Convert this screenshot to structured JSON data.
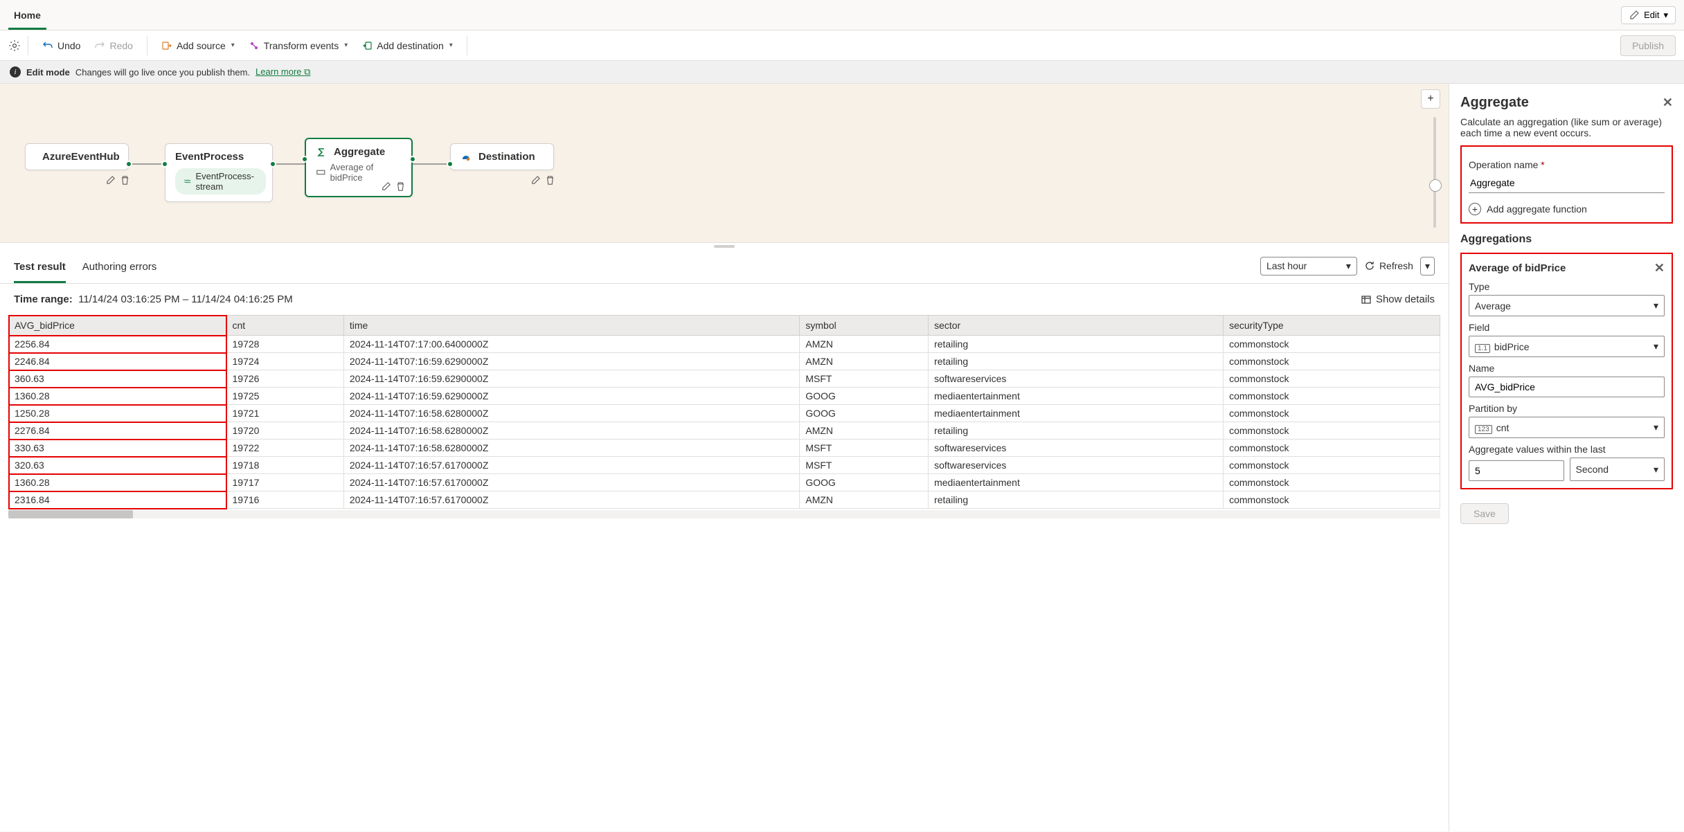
{
  "tabs": {
    "home": "Home"
  },
  "editButton": "Edit",
  "toolbar": {
    "undo": "Undo",
    "redo": "Redo",
    "addSource": "Add source",
    "transformEvents": "Transform events",
    "addDestination": "Add destination",
    "publish": "Publish"
  },
  "infoBar": {
    "mode": "Edit mode",
    "msg": "Changes will go live once you publish them.",
    "link": "Learn more"
  },
  "canvas": {
    "nodes": {
      "source": {
        "title": "AzureEventHub"
      },
      "process": {
        "title": "EventProcess",
        "stream": "EventProcess-stream"
      },
      "aggregate": {
        "title": "Aggregate",
        "subtitle": "Average of bidPrice"
      },
      "destination": {
        "title": "Destination"
      }
    }
  },
  "results": {
    "tabs": {
      "test": "Test result",
      "errors": "Authoring errors"
    },
    "timeFilter": "Last hour",
    "refresh": "Refresh",
    "timeRangeLabel": "Time range:",
    "timeRangeValue": "11/14/24 03:16:25 PM  –  11/14/24 04:16:25 PM",
    "showDetails": "Show details",
    "columns": [
      "AVG_bidPrice",
      "cnt",
      "time",
      "symbol",
      "sector",
      "securityType"
    ],
    "rows": [
      [
        "2256.84",
        "19728",
        "2024-11-14T07:17:00.6400000Z",
        "AMZN",
        "retailing",
        "commonstock"
      ],
      [
        "2246.84",
        "19724",
        "2024-11-14T07:16:59.6290000Z",
        "AMZN",
        "retailing",
        "commonstock"
      ],
      [
        "360.63",
        "19726",
        "2024-11-14T07:16:59.6290000Z",
        "MSFT",
        "softwareservices",
        "commonstock"
      ],
      [
        "1360.28",
        "19725",
        "2024-11-14T07:16:59.6290000Z",
        "GOOG",
        "mediaentertainment",
        "commonstock"
      ],
      [
        "1250.28",
        "19721",
        "2024-11-14T07:16:58.6280000Z",
        "GOOG",
        "mediaentertainment",
        "commonstock"
      ],
      [
        "2276.84",
        "19720",
        "2024-11-14T07:16:58.6280000Z",
        "AMZN",
        "retailing",
        "commonstock"
      ],
      [
        "330.63",
        "19722",
        "2024-11-14T07:16:58.6280000Z",
        "MSFT",
        "softwareservices",
        "commonstock"
      ],
      [
        "320.63",
        "19718",
        "2024-11-14T07:16:57.6170000Z",
        "MSFT",
        "softwareservices",
        "commonstock"
      ],
      [
        "1360.28",
        "19717",
        "2024-11-14T07:16:57.6170000Z",
        "GOOG",
        "mediaentertainment",
        "commonstock"
      ],
      [
        "2316.84",
        "19716",
        "2024-11-14T07:16:57.6170000Z",
        "AMZN",
        "retailing",
        "commonstock"
      ]
    ]
  },
  "panel": {
    "title": "Aggregate",
    "desc": "Calculate an aggregation (like sum or average) each time a new event occurs.",
    "opNameLabel": "Operation name",
    "opNameValue": "Aggregate",
    "addFunc": "Add aggregate function",
    "aggSection": "Aggregations",
    "aggCardTitle": "Average of bidPrice",
    "typeLabel": "Type",
    "typeValue": "Average",
    "fieldLabel": "Field",
    "fieldValue": "bidPrice",
    "nameLabel": "Name",
    "nameValue": "AVG_bidPrice",
    "partitionLabel": "Partition by",
    "partitionValue": "cnt",
    "windowLabel": "Aggregate values within the last",
    "windowValue": "5",
    "windowUnit": "Second",
    "save": "Save"
  }
}
